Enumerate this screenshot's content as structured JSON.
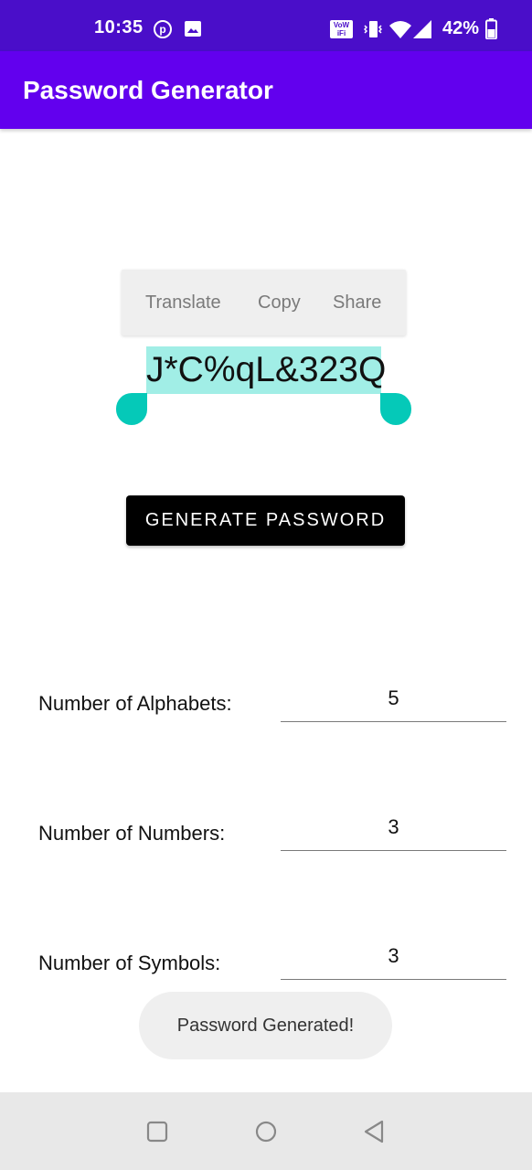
{
  "status_bar": {
    "time": "10:35",
    "wifi_call_label": "VoWiFi",
    "battery_percent": "42%",
    "icons": [
      "pinterest-icon",
      "image-icon",
      "wifi-calling-icon",
      "vibrate-icon",
      "wifi-icon",
      "signal-icon",
      "battery-icon"
    ]
  },
  "app_bar": {
    "title": "Password Generator",
    "color": "#6200ee"
  },
  "selection_toolbar": {
    "translate": "Translate",
    "copy": "Copy",
    "share": "Share"
  },
  "password": {
    "value": "J*C%qL&323Q",
    "selection_color": "#a1eee6",
    "handle_color": "#05c9b8"
  },
  "generate_button": {
    "label": "GENERATE PASSWORD"
  },
  "fields": [
    {
      "label": "Number of Alphabets:",
      "value": "5"
    },
    {
      "label": "Number of Numbers:",
      "value": "3"
    },
    {
      "label": "Number of Symbols:",
      "value": "3"
    }
  ],
  "toast": {
    "message": "Password Generated!"
  },
  "nav_bar": {
    "icons": [
      "recent-apps-icon",
      "home-icon",
      "back-icon"
    ]
  }
}
